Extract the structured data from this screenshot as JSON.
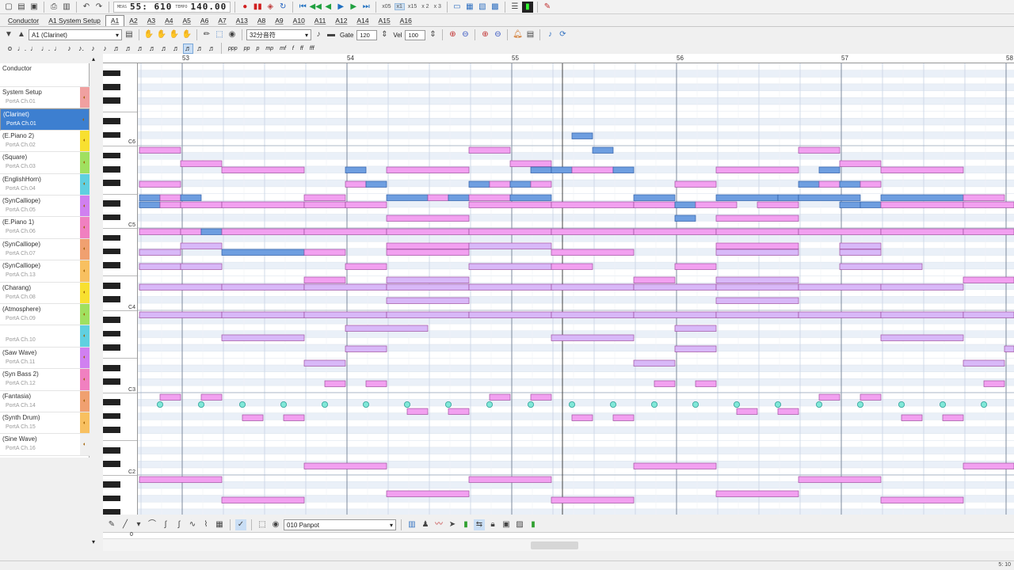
{
  "app": {
    "meas_label": "MEAS",
    "position": "55: 610",
    "tempo_label": "TEMPO",
    "tempo": "140.00",
    "speeds": [
      "x05",
      "x1",
      "x15",
      "x 2",
      "x 3"
    ],
    "status": "5: 10"
  },
  "tabs": [
    "Conductor",
    "A1 System Setup",
    "A1",
    "A2",
    "A3",
    "A4",
    "A5",
    "A6",
    "A7",
    "A13",
    "A8",
    "A9",
    "A10",
    "A11",
    "A12",
    "A14",
    "A15",
    "A16"
  ],
  "toolbar": {
    "track_select": "A1 (Clarinet)",
    "note_value": "32分音符",
    "gate_label": "Gate",
    "gate": "120",
    "vel_label": "Vel",
    "vel": "100"
  },
  "notes_row": {
    "dynamics": [
      "ppp",
      "pp",
      "p",
      "mp",
      "mf",
      "f",
      "ff",
      "fff"
    ]
  },
  "tracks": [
    {
      "name": "Conductor",
      "port": "",
      "color": "#ffffff"
    },
    {
      "name": "System Setup",
      "port": "PortA  Ch.01",
      "color": "#f0a0a0"
    },
    {
      "name": "(Clarinet)",
      "port": "PortA  Ch.01",
      "color": "#3d7fd0",
      "selected": true
    },
    {
      "name": "(E.Piano 2)",
      "port": "PortA  Ch.02",
      "color": "#f8e030"
    },
    {
      "name": "(Square)",
      "port": "PortA  Ch.03",
      "color": "#a0e060"
    },
    {
      "name": "(EnglishHorn)",
      "port": "PortA  Ch.04",
      "color": "#60d0e0"
    },
    {
      "name": "(SynCalliope)",
      "port": "PortA  Ch.05",
      "color": "#d080f0"
    },
    {
      "name": "(E.Piano 1)",
      "port": "PortA  Ch.06",
      "color": "#f080c0"
    },
    {
      "name": "(SynCalliope)",
      "port": "PortA  Ch.07",
      "color": "#f0a070"
    },
    {
      "name": "(SynCalliope)",
      "port": "PortA  Ch.13",
      "color": "#f8c060"
    },
    {
      "name": "(Charang)",
      "port": "PortA  Ch.08",
      "color": "#f8e030"
    },
    {
      "name": "(Atmosphere)",
      "port": "PortA  Ch.09",
      "color": "#a0e060"
    },
    {
      "name": "",
      "port": "PortA  Ch.10",
      "color": "#60d0e0"
    },
    {
      "name": "(Saw Wave)",
      "port": "PortA  Ch.11",
      "color": "#d080f0"
    },
    {
      "name": "(Syn Bass 2)",
      "port": "PortA  Ch.12",
      "color": "#f080c0"
    },
    {
      "name": "(Fantasia)",
      "port": "PortA  Ch.14",
      "color": "#f0a070"
    },
    {
      "name": "(Synth Drum)",
      "port": "PortA  Ch.15",
      "color": "#f8c060"
    },
    {
      "name": "(Sine Wave)",
      "port": "PortA  Ch.16",
      "color": "#f0f0f0"
    }
  ],
  "ruler": {
    "measures": [
      "53",
      "54",
      "55",
      "56",
      "57",
      "58"
    ]
  },
  "octaves": [
    "C6",
    "C5",
    "C4",
    "C3",
    "C2"
  ],
  "bottom": {
    "controller": "010 Panpot",
    "zero": "0"
  },
  "colors": {
    "note_pink": "#f2a0f0",
    "note_blue": "#6e9ee0",
    "note_lilac": "#d8b8f8",
    "ctrl_cyan": "#80e8d8"
  }
}
